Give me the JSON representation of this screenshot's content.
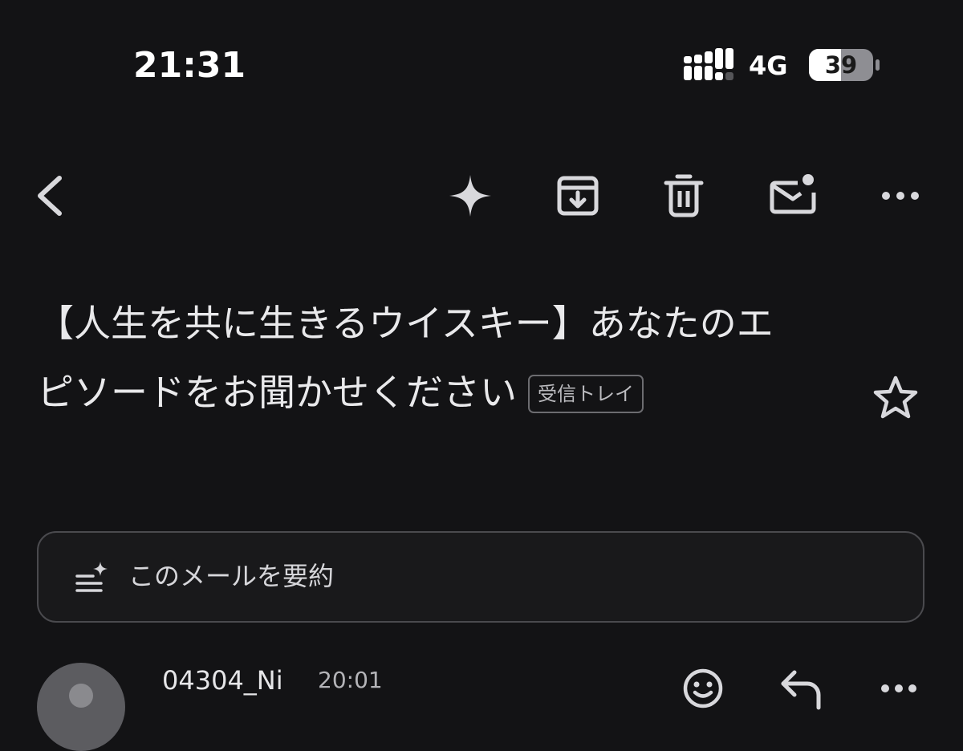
{
  "status_bar": {
    "time": "21:31",
    "network": "4G",
    "battery": "39"
  },
  "toolbar": {
    "icons": [
      "back-arrow-icon",
      "gemini-sparkle-icon",
      "archive-icon",
      "trash-icon",
      "mark-unread-icon",
      "more-icon"
    ]
  },
  "email": {
    "subject": "【人生を共に生きるウイスキー】あなたのエピソードをお聞かせください",
    "label": "受信トレイ",
    "summarize_label": "このメールを要約"
  },
  "message": {
    "sender": "04304_Ni",
    "time": "20:01"
  },
  "colors": {
    "background": "#131315",
    "text": "#e6e6e8",
    "muted": "#b4b4b8",
    "border": "#4a4a4e"
  }
}
